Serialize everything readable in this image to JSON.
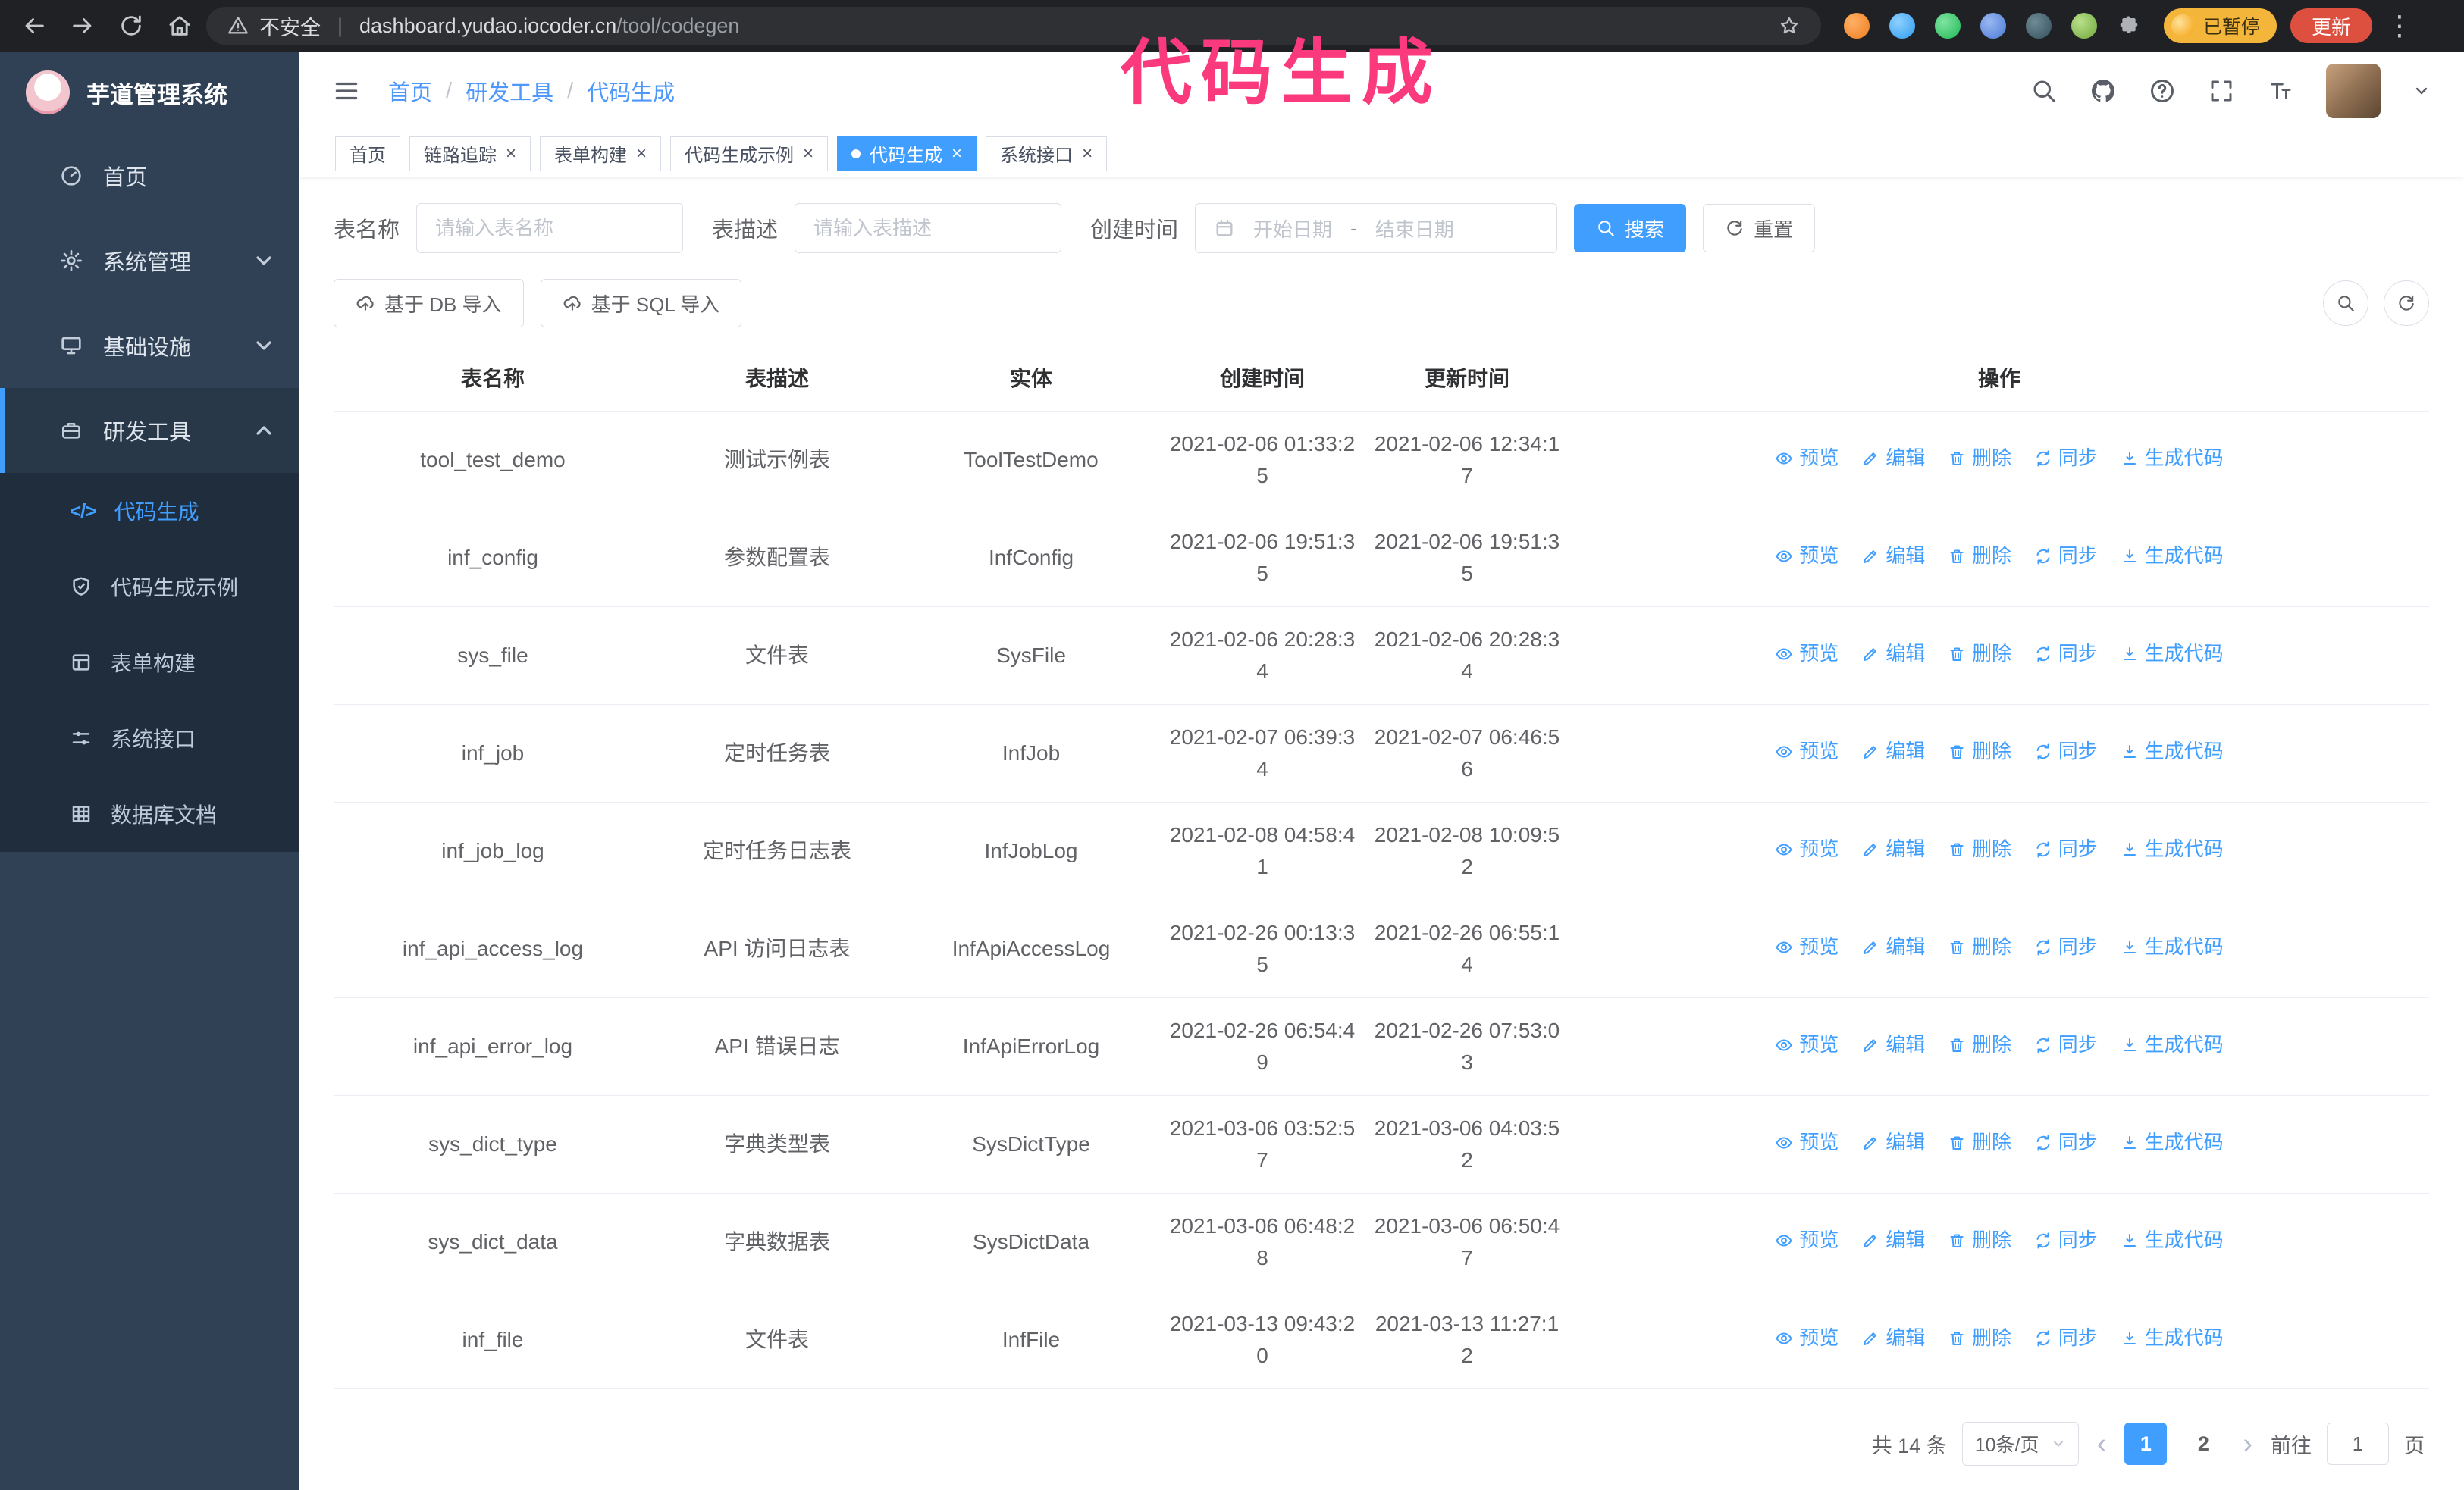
{
  "colors": {
    "accent": "#409eff",
    "annotation": "#fb3a7d",
    "sidebar_bg": "#304156",
    "submenu_bg": "#1f2d3d"
  },
  "annotation": {
    "text": "代码生成"
  },
  "browser": {
    "insecure_label": "不安全",
    "url_separator": "|",
    "url_host": "dashboard.yudao.iocoder.cn",
    "url_path": "/tool/codegen",
    "paused_badge": "已暂停",
    "update_button": "更新"
  },
  "sidebar": {
    "app_title": "芋道管理系统",
    "items": [
      {
        "label": "首页"
      },
      {
        "label": "系统管理"
      },
      {
        "label": "基础设施"
      },
      {
        "label": "研发工具"
      }
    ],
    "subitems": [
      {
        "label": "代码生成"
      },
      {
        "label": "代码生成示例"
      },
      {
        "label": "表单构建"
      },
      {
        "label": "系统接口"
      },
      {
        "label": "数据库文档"
      }
    ]
  },
  "header": {
    "separator": "/",
    "breadcrumb": [
      {
        "label": "首页"
      },
      {
        "label": "研发工具"
      },
      {
        "label": "代码生成"
      }
    ]
  },
  "tabs": [
    {
      "label": "首页"
    },
    {
      "label": "链路追踪"
    },
    {
      "label": "表单构建"
    },
    {
      "label": "代码生成示例"
    },
    {
      "label": "代码生成"
    },
    {
      "label": "系统接口"
    }
  ],
  "filters": {
    "table_name_label": "表名称",
    "table_name_placeholder": "请输入表名称",
    "table_desc_label": "表描述",
    "table_desc_placeholder": "请输入表描述",
    "create_time_label": "创建时间",
    "date_start_placeholder": "开始日期",
    "date_separator": "-",
    "date_end_placeholder": "结束日期",
    "search_button": "搜索",
    "reset_button": "重置"
  },
  "toolbar": {
    "import_db_button": "基于 DB 导入",
    "import_sql_button": "基于 SQL 导入"
  },
  "table": {
    "columns": [
      "表名称",
      "表描述",
      "实体",
      "创建时间",
      "更新时间",
      "操作"
    ],
    "actions": [
      "预览",
      "编辑",
      "删除",
      "同步",
      "生成代码"
    ],
    "rows": [
      {
        "name": "tool_test_demo",
        "desc": "测试示例表",
        "entity": "ToolTestDemo",
        "created": "2021-02-06 01:33:25",
        "updated": "2021-02-06 12:34:17"
      },
      {
        "name": "inf_config",
        "desc": "参数配置表",
        "entity": "InfConfig",
        "created": "2021-02-06 19:51:35",
        "updated": "2021-02-06 19:51:35"
      },
      {
        "name": "sys_file",
        "desc": "文件表",
        "entity": "SysFile",
        "created": "2021-02-06 20:28:34",
        "updated": "2021-02-06 20:28:34"
      },
      {
        "name": "inf_job",
        "desc": "定时任务表",
        "entity": "InfJob",
        "created": "2021-02-07 06:39:34",
        "updated": "2021-02-07 06:46:56"
      },
      {
        "name": "inf_job_log",
        "desc": "定时任务日志表",
        "entity": "InfJobLog",
        "created": "2021-02-08 04:58:41",
        "updated": "2021-02-08 10:09:52"
      },
      {
        "name": "inf_api_access_log",
        "desc": "API 访问日志表",
        "entity": "InfApiAccessLog",
        "created": "2021-02-26 00:13:35",
        "updated": "2021-02-26 06:55:14"
      },
      {
        "name": "inf_api_error_log",
        "desc": "API 错误日志",
        "entity": "InfApiErrorLog",
        "created": "2021-02-26 06:54:49",
        "updated": "2021-02-26 07:53:03"
      },
      {
        "name": "sys_dict_type",
        "desc": "字典类型表",
        "entity": "SysDictType",
        "created": "2021-03-06 03:52:57",
        "updated": "2021-03-06 04:03:52"
      },
      {
        "name": "sys_dict_data",
        "desc": "字典数据表",
        "entity": "SysDictData",
        "created": "2021-03-06 06:48:28",
        "updated": "2021-03-06 06:50:47"
      },
      {
        "name": "inf_file",
        "desc": "文件表",
        "entity": "InfFile",
        "created": "2021-03-13 09:43:20",
        "updated": "2021-03-13 11:27:12"
      }
    ]
  },
  "pagination": {
    "total": "共 14 条",
    "page_size": "10条/页",
    "prev": "‹",
    "next": "›",
    "pages": [
      {
        "label": "1"
      },
      {
        "label": "2"
      }
    ],
    "active_page": "1",
    "goto_label": "前往",
    "goto_value": "1",
    "goto_suffix": "页"
  }
}
